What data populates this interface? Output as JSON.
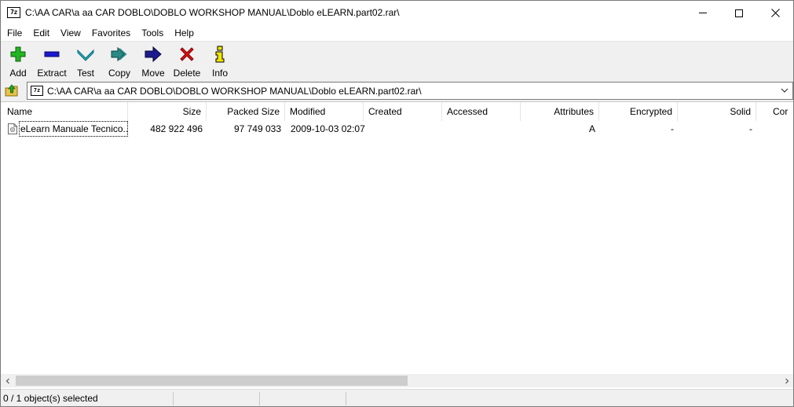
{
  "window": {
    "app_icon": "7-zip-icon",
    "title": "C:\\AA CAR\\a aa CAR DOBLO\\DOBLO WORKSHOP MANUAL\\Doblo eLEARN.part02.rar\\",
    "app_icon_text": "7z"
  },
  "menu": [
    "File",
    "Edit",
    "View",
    "Favorites",
    "Tools",
    "Help"
  ],
  "toolbar": {
    "add": "Add",
    "extract": "Extract",
    "test": "Test",
    "copy": "Copy",
    "move": "Move",
    "delete": "Delete",
    "info": "Info"
  },
  "address": {
    "path": "C:\\AA CAR\\a aa CAR DOBLO\\DOBLO WORKSHOP MANUAL\\Doblo eLEARN.part02.rar\\"
  },
  "columns": {
    "name": "Name",
    "size": "Size",
    "packed_size": "Packed Size",
    "modified": "Modified",
    "created": "Created",
    "accessed": "Accessed",
    "attributes": "Attributes",
    "encrypted": "Encrypted",
    "solid": "Solid",
    "comment": "Cor"
  },
  "files": [
    {
      "name": "eLearn Manuale Tecnico...",
      "size": "482 922 496",
      "packed_size": "97 749 033",
      "modified": "2009-10-03 02:07",
      "created": "",
      "accessed": "",
      "attributes": "A",
      "encrypted": "-",
      "solid": "-"
    }
  ],
  "status": {
    "selection": "0 / 1 object(s) selected",
    "pane2": "",
    "pane3": ""
  },
  "colors": {
    "toolbar_bg": "#f0f0f0",
    "add_green": "#22b422",
    "extract_blue": "#1a1ad0",
    "test_cyan": "#1fb8c8",
    "copy_teal": "#2a8a86",
    "move_navy": "#1c1c8c",
    "delete_red": "#e01010",
    "info_yellow": "#f2e600"
  }
}
